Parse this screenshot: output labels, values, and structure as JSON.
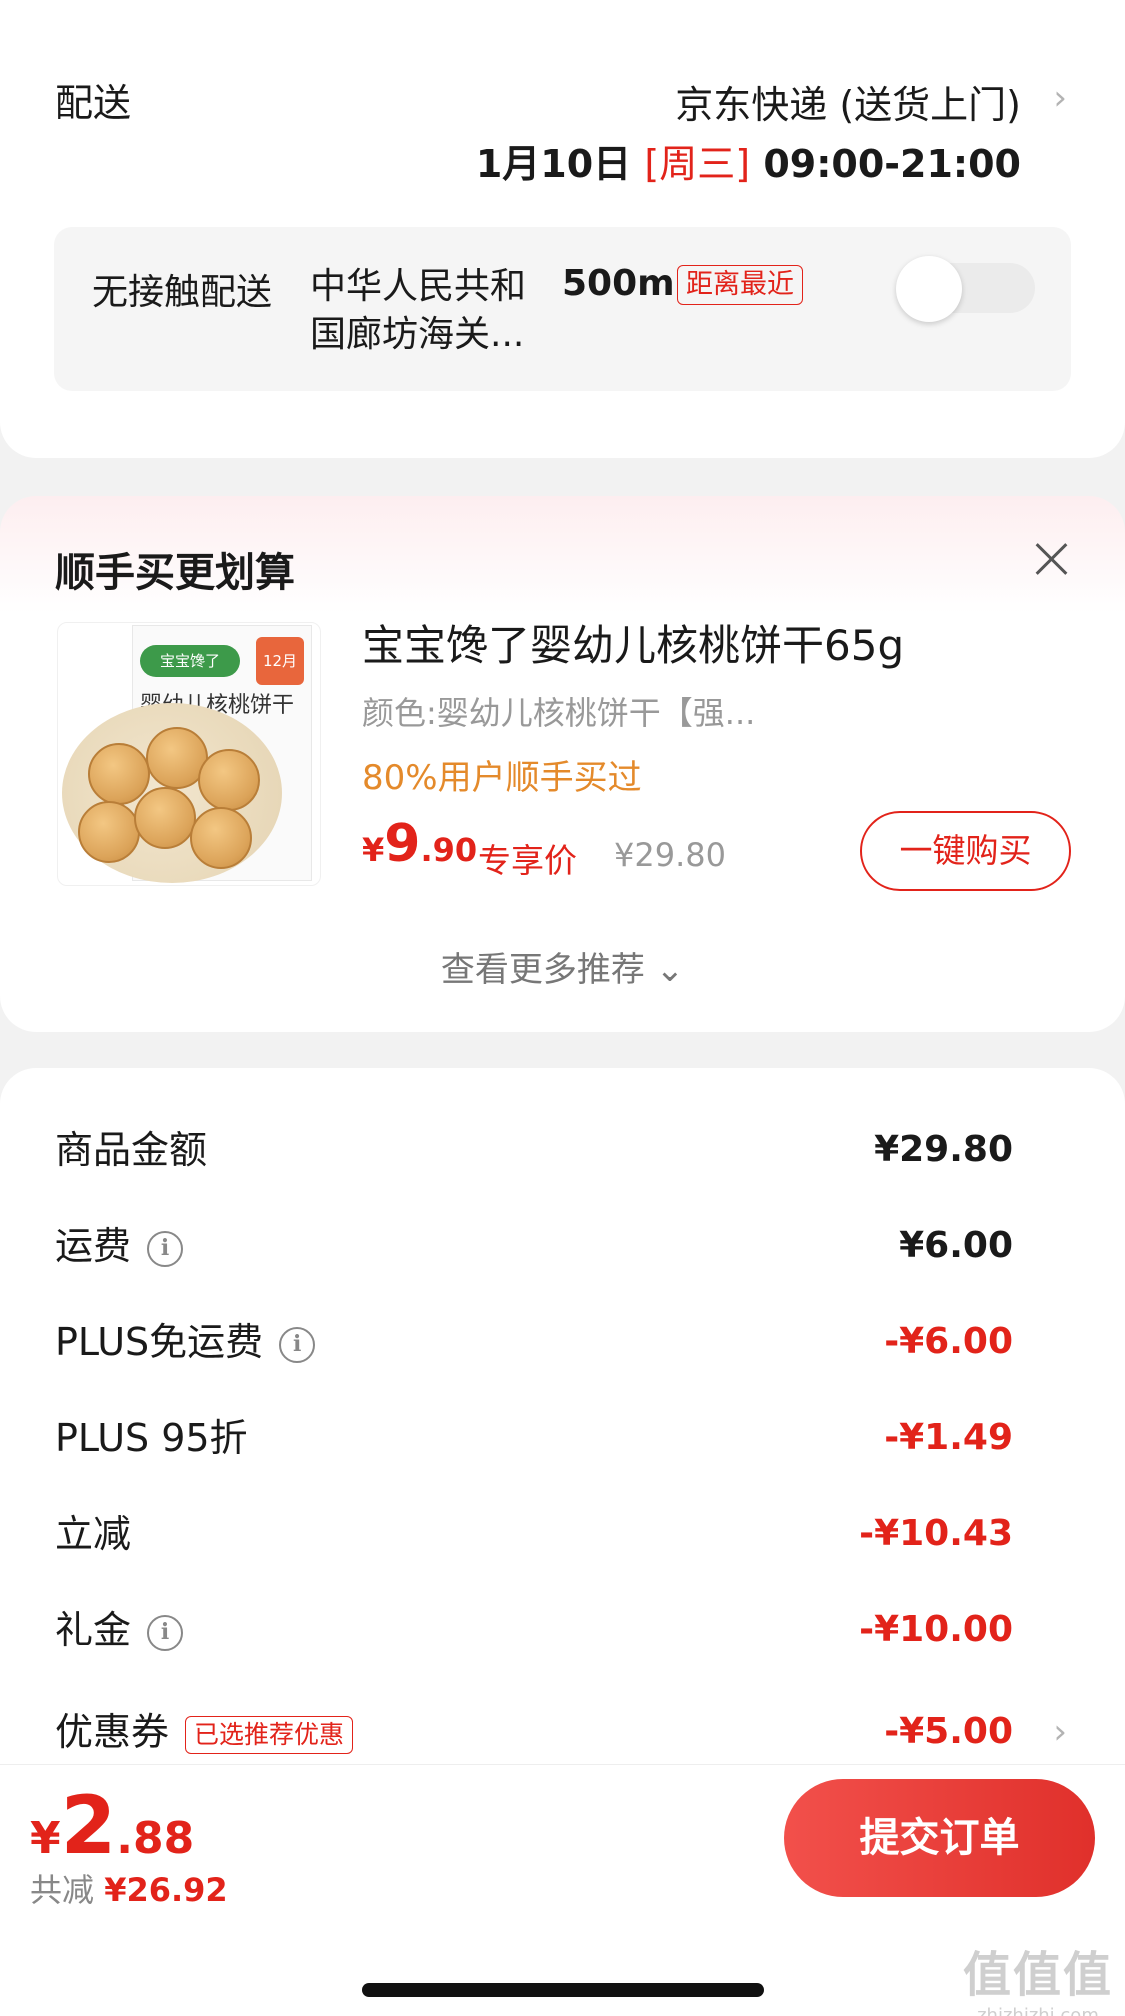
{
  "delivery": {
    "label": "配送",
    "method": "京东快递 (送货上门)",
    "date": "1月10日",
    "weekday": "[周三]",
    "time_window": "09:00-21:00",
    "contactless": {
      "title": "无接触配送",
      "address": "中华人民共和国廊坊海关...",
      "distance": "500m",
      "badge": "距离最近",
      "enabled": false
    }
  },
  "recommend": {
    "title": "顺手买更划算",
    "product": {
      "image_brand": "宝宝馋了",
      "image_month": "12月",
      "image_name": "婴幼儿核桃饼干",
      "title": "宝宝馋了婴幼儿核桃饼干65g",
      "spec": "颜色:婴幼儿核桃饼干【强...",
      "users": "80%用户顺手买过",
      "price_symbol": "¥",
      "price_int": "9",
      "price_dec": ".90",
      "exclusive_label": "专享价",
      "original_price": "¥29.80",
      "buy_button": "一键购买"
    },
    "more_label": "查看更多推荐 ⌄"
  },
  "price_breakdown": {
    "rows": [
      {
        "label": "商品金额",
        "value": "¥29.80"
      },
      {
        "label": "运费",
        "value": "¥6.00"
      },
      {
        "label": "PLUS免运费",
        "value": "-¥6.00"
      },
      {
        "label": "PLUS 95折",
        "value": "-¥1.49"
      },
      {
        "label": "立减",
        "value": "-¥10.43"
      },
      {
        "label": "礼金",
        "value": "-¥10.00"
      },
      {
        "label": "优惠券",
        "badge": "已选推荐优惠",
        "value": "-¥5.00"
      }
    ]
  },
  "bottom": {
    "total_symbol": "¥",
    "total_int": "2",
    "total_dec": ".88",
    "saved_label": "共减",
    "saved_amount": "¥26.92",
    "submit": "提交订单"
  },
  "watermark": {
    "big": "值值值",
    "small": "zhizhizhi.com"
  },
  "colors": {
    "accent": "#e2231a",
    "orange": "#e48a2b",
    "green": "#4cc65a"
  }
}
